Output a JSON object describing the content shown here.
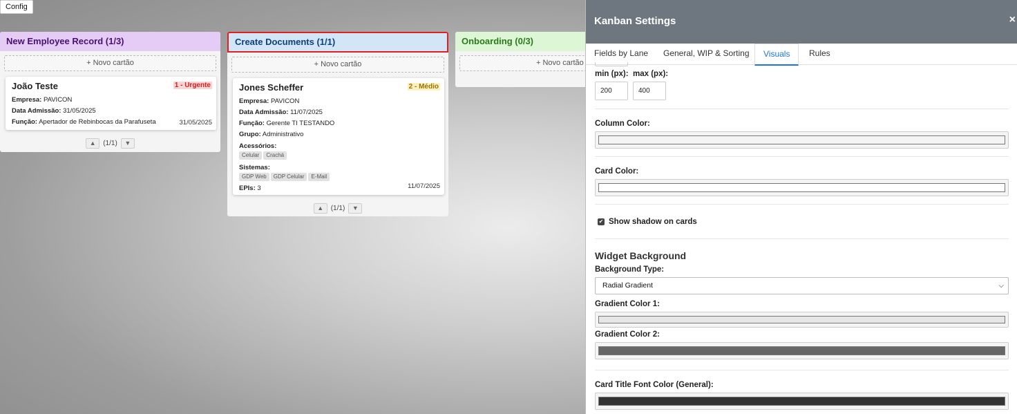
{
  "config_button": "Config",
  "columns": [
    {
      "title": "New Employee Record (1/3)",
      "header_bg": "#e4ccf6",
      "header_color": "#4a1070",
      "add_card": "+ Novo cartão",
      "cards": [
        {
          "title": "João Teste",
          "priority": "1 - Urgente",
          "priority_color": "#d42020",
          "priority_bg": "#fbd4d4",
          "fields": [
            {
              "label": "Empresa:",
              "value": "PAVICON"
            },
            {
              "label": "Data Admissão:",
              "value": "31/05/2025"
            },
            {
              "label": "Função:",
              "value": "Apertador de Rebinbocas da Parafuseta"
            }
          ],
          "date": "31/05/2025"
        }
      ],
      "pager": "(1/1)"
    },
    {
      "title": "Create Documents (1/1)",
      "header_bg": "#d3e6f8",
      "header_color": "#0d3f7a",
      "add_card": "+ Novo cartão",
      "cards": [
        {
          "title": "Jones Scheffer",
          "priority": "2 - Médio",
          "priority_color": "#9a7400",
          "priority_bg": "#fbf0c0",
          "fields": [
            {
              "label": "Empresa:",
              "value": "PAVICON"
            },
            {
              "label": "Data Admissão:",
              "value": "11/07/2025"
            },
            {
              "label": "Função:",
              "value": "Gerente TI TESTANDO"
            },
            {
              "label": "Grupo:",
              "value": "Administrativo"
            }
          ],
          "accessories_label": "Acessórios:",
          "accessories": [
            "Celular",
            "Crachá"
          ],
          "systems_label": "Sistemas:",
          "systems": [
            "GDP Web",
            "GDP Celular",
            "E-Mail"
          ],
          "epis_label": "EPIs:",
          "epis_value": "3",
          "date": "11/07/2025"
        }
      ],
      "pager": "(1/1)"
    },
    {
      "title": "Onboarding (0/3)",
      "header_bg": "#dcf6d6",
      "header_color": "#2a7a1a",
      "add_card": "+ Novo cartão"
    }
  ],
  "settings_panel": {
    "title": "Kanban Settings",
    "close": "×",
    "tabs": [
      "Fields by Lane",
      "General, WIP & Sorting",
      "Visuals",
      "Rules"
    ],
    "active_tab": "Visuals",
    "min_label": "min (px):",
    "max_label": "max (px):",
    "min_value": "200",
    "max_value": "400",
    "column_color_label": "Column Color:",
    "column_color": "#f4f4f4",
    "card_color_label": "Card Color:",
    "card_color": "#ffffff",
    "shadow_label": "Show shadow on cards",
    "shadow_checked": true,
    "widget_bg_heading": "Widget Background",
    "bg_type_label": "Background Type:",
    "bg_type_value": "Radial Gradient",
    "gradient1_label": "Gradient Color 1:",
    "gradient1_color": "#e6e6e6",
    "gradient2_label": "Gradient Color 2:",
    "gradient2_color": "#666666",
    "title_font_label": "Card Title Font Color (General):",
    "title_font_color": "#333333"
  }
}
